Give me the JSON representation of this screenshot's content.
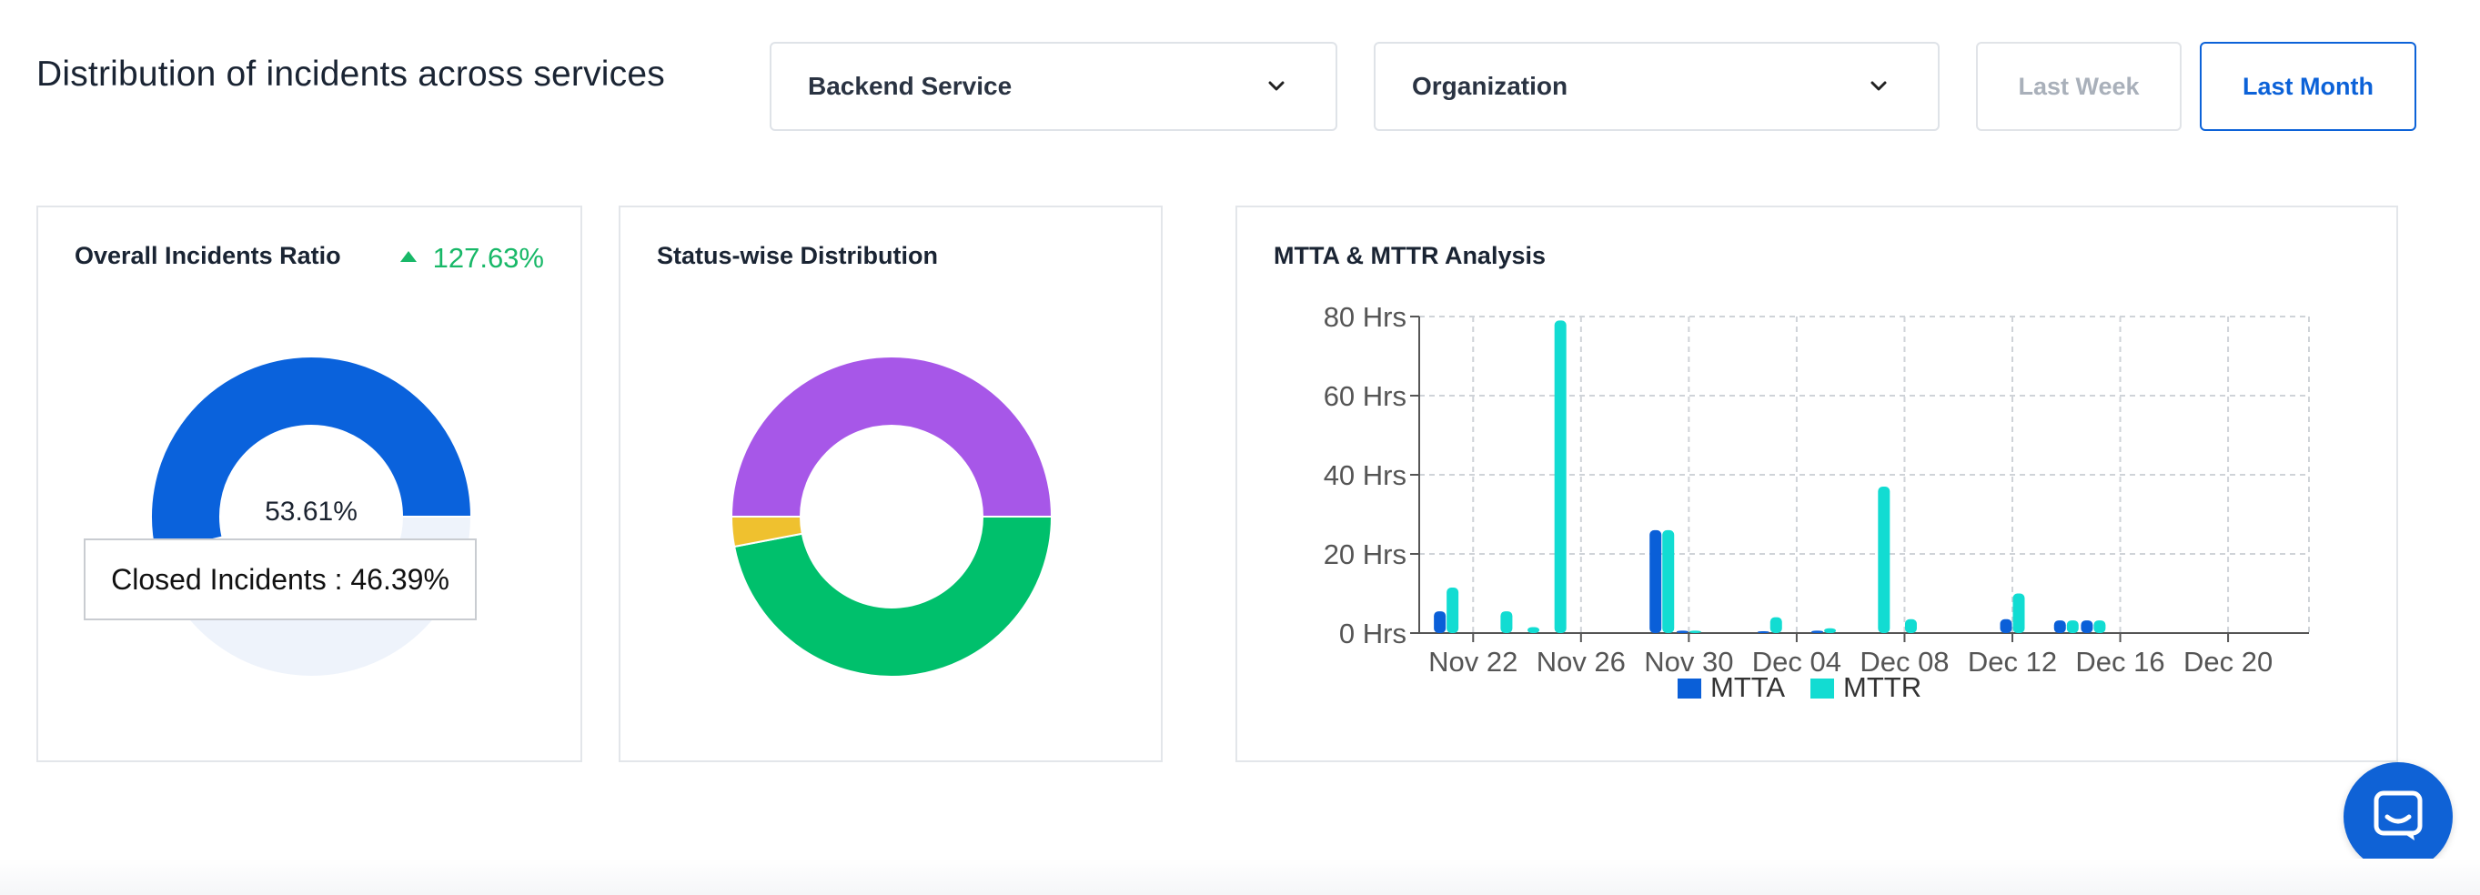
{
  "header": {
    "title": "Distribution of incidents across services",
    "service_dropdown": "Backend Service",
    "org_dropdown": "Organization",
    "range_buttons": {
      "week": "Last Week",
      "month": "Last Month"
    },
    "selected_range": "Last Month"
  },
  "cards": {
    "ratio": {
      "title": "Overall Incidents Ratio",
      "change": "127.63%",
      "change_direction": "up",
      "center_label": "53.61%",
      "tooltip": "Closed Incidents : 46.39%",
      "slices": [
        {
          "value": 53.61,
          "color": "#0a62dc"
        },
        {
          "value": 46.39,
          "color": "#eef3fb"
        }
      ]
    },
    "status": {
      "title": "Status-wise Distribution",
      "slices": [
        {
          "value": 50.0,
          "color": "#a757e8"
        },
        {
          "value": 3.0,
          "color": "#efc12f"
        },
        {
          "value": 47.0,
          "color": "#00c06c"
        }
      ]
    },
    "mtta": {
      "title": "MTTA & MTTR Analysis"
    }
  },
  "chart_data": {
    "type": "bar",
    "title": "MTTA & MTTR Analysis",
    "xlabel": "",
    "ylabel": "",
    "x_tick_labels": [
      "Nov 22",
      "Nov 26",
      "Nov 30",
      "Dec 04",
      "Dec 08",
      "Dec 12",
      "Dec 16",
      "Dec 20"
    ],
    "y_ticks": [
      "0 Hrs",
      "20 Hrs",
      "40 Hrs",
      "60 Hrs",
      "80 Hrs"
    ],
    "ylim": [
      0,
      80
    ],
    "grid": true,
    "legend_position": "bottom",
    "series": [
      {
        "name": "MTTA",
        "color": "#0a5fd8",
        "points": [
          {
            "x": "Nov 21",
            "y": 5.5
          },
          {
            "x": "Nov 29",
            "y": 26
          },
          {
            "x": "Nov 30",
            "y": 0.6
          },
          {
            "x": "Dec 03",
            "y": 0.3
          },
          {
            "x": "Dec 05",
            "y": 0.6
          },
          {
            "x": "Dec 12",
            "y": 3.5
          },
          {
            "x": "Dec 14",
            "y": 3.2
          },
          {
            "x": "Dec 15",
            "y": 3.2
          }
        ]
      },
      {
        "name": "MTTR",
        "color": "#12dcd2",
        "points": [
          {
            "x": "Nov 21",
            "y": 11.5
          },
          {
            "x": "Nov 23",
            "y": 5.5
          },
          {
            "x": "Nov 24",
            "y": 1.5
          },
          {
            "x": "Nov 25",
            "y": 79
          },
          {
            "x": "Nov 29",
            "y": 26
          },
          {
            "x": "Nov 30",
            "y": 0.6
          },
          {
            "x": "Dec 03",
            "y": 4
          },
          {
            "x": "Dec 05",
            "y": 1.2
          },
          {
            "x": "Dec 07",
            "y": 37
          },
          {
            "x": "Dec 08",
            "y": 3.5
          },
          {
            "x": "Dec 12",
            "y": 10
          },
          {
            "x": "Dec 14",
            "y": 3.2
          },
          {
            "x": "Dec 15",
            "y": 3.2
          }
        ]
      }
    ]
  }
}
